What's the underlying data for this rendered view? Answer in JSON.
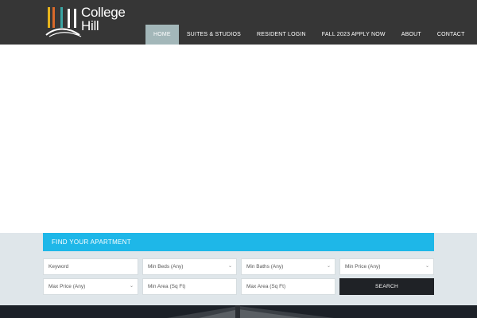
{
  "brand": {
    "line1": "College",
    "line2": "Hill",
    "colors": {
      "yellow": "#e7b41d",
      "teal": "#3aa6a4",
      "orange": "#d8692a",
      "white": "#ffffff"
    }
  },
  "nav": {
    "items": [
      {
        "label": "HOME",
        "active": true
      },
      {
        "label": "SUITES & STUDIOS",
        "active": false
      },
      {
        "label": "RESIDENT LOGIN",
        "active": false
      },
      {
        "label": "FALL 2023 APPLY NOW",
        "active": false
      },
      {
        "label": "ABOUT",
        "active": false
      },
      {
        "label": "CONTACT",
        "active": false
      }
    ]
  },
  "search": {
    "title": "FIND YOUR APARTMENT",
    "keyword_placeholder": "Keyword",
    "min_beds": "Min Beds (Any)",
    "min_baths": "Min Baths (Any)",
    "min_price": "Min Price (Any)",
    "max_price": "Max Price (Any)",
    "min_area": "Min Area (Sq Ft)",
    "max_area": "Max Area (Sq Ft)",
    "button_label": "SEARCH"
  },
  "colors": {
    "header_bg": "#363636",
    "nav_active": "#a3b7b9",
    "find_bar": "#1eb7e8",
    "band_bg": "#dfe6ea",
    "search_button": "#1f2226"
  }
}
